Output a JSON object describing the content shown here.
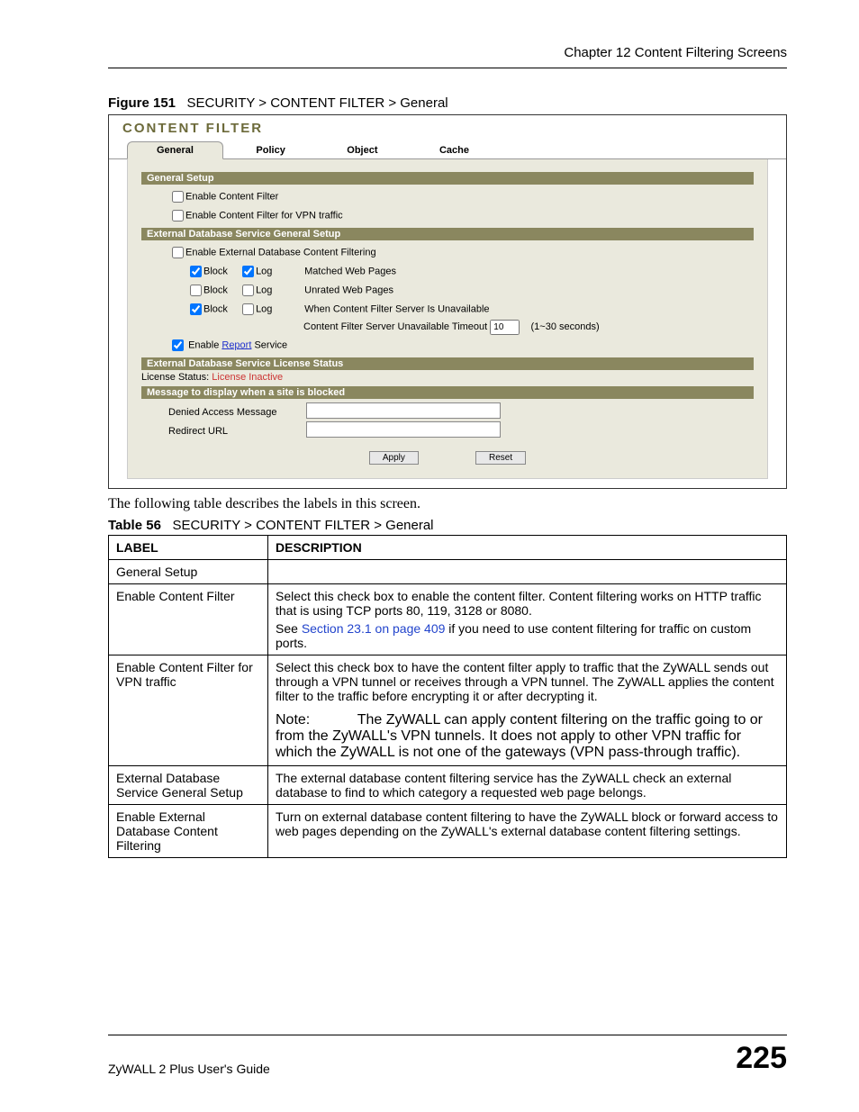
{
  "header": {
    "chapter": "Chapter 12 Content Filtering Screens"
  },
  "figure": {
    "label": "Figure 151",
    "title": "SECURITY > CONTENT FILTER > General"
  },
  "app": {
    "title": "CONTENT FILTER",
    "tabs": [
      "General",
      "Policy",
      "Object",
      "Cache"
    ],
    "sections": {
      "general_setup": "General Setup",
      "enable_cf": "Enable Content Filter",
      "enable_cf_vpn": "Enable Content Filter for VPN traffic",
      "ext_db_setup": "External Database Service General Setup",
      "enable_ext_db": "Enable External Database Content Filtering",
      "block": "Block",
      "log": "Log",
      "matched": "Matched Web Pages",
      "unrated": "Unrated Web Pages",
      "when_unavail": "When Content Filter Server Is Unavailable",
      "timeout_label": "Content Filter Server Unavailable Timeout",
      "timeout_value": "10",
      "timeout_hint": "(1~30 seconds)",
      "enable_report_pre": "Enable ",
      "enable_report_link": "Report",
      "enable_report_post": " Service",
      "license_header": "External Database Service License Status",
      "license_label": "License Status: ",
      "license_value": "License Inactive",
      "message_header": "Message to display when a site is blocked",
      "denied_msg": "Denied Access Message",
      "redirect_url": "Redirect URL",
      "apply": "Apply",
      "reset": "Reset"
    }
  },
  "paragraph": "The following table describes the labels in this screen.",
  "table": {
    "label": "Table 56",
    "title": "SECURITY > CONTENT FILTER > General",
    "head_label": "LABEL",
    "head_desc": "DESCRIPTION",
    "rows": [
      {
        "label": "General Setup",
        "desc": ""
      },
      {
        "label": "Enable Content Filter",
        "desc1": "Select this check box to enable the content filter. Content filtering works on HTTP traffic that is using TCP ports 80, 119, 3128 or 8080.",
        "desc2a": "See ",
        "xref": "Section 23.1 on page 409",
        "desc2b": " if you need to use content filtering for traffic on custom ports."
      },
      {
        "label": "Enable Content Filter for VPN traffic",
        "desc": "Select this check box to have the content filter apply to traffic that the ZyWALL sends out through a VPN tunnel or receives through a VPN tunnel. The ZyWALL applies the content filter to the traffic before encrypting it or after decrypting it.",
        "note_prefix": "Note: ",
        "note": "The ZyWALL can apply content filtering on the traffic going to or from the ZyWALL's VPN tunnels. It does not apply to other VPN traffic for which the ZyWALL is not one of the gateways (VPN pass-through traffic)."
      },
      {
        "label": "External Database Service General Setup",
        "desc": "The external database content filtering service has the ZyWALL check an external database to find to which category a requested web page belongs."
      },
      {
        "label": "Enable External Database Content Filtering",
        "desc": "Turn on external database content filtering to have the ZyWALL block or forward access to web pages depending on the ZyWALL's external database content filtering settings."
      }
    ]
  },
  "footer": {
    "guide": "ZyWALL 2 Plus User's Guide",
    "page": "225"
  }
}
